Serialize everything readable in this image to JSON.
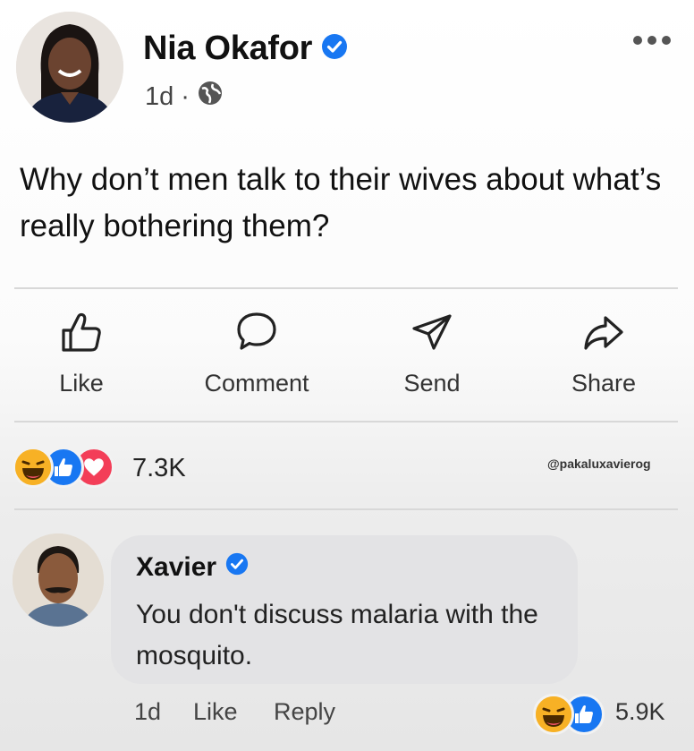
{
  "post": {
    "author": "Nia Okafor",
    "time": "1d",
    "separator": "·",
    "text": "Why don’t men talk to their wives about what’s really bothering them?"
  },
  "actions": {
    "like": "Like",
    "comment": "Comment",
    "send": "Send",
    "share": "Share"
  },
  "reactions": {
    "icons": [
      "haha-icon",
      "like-icon",
      "love-icon"
    ],
    "count": "7.3K",
    "watermark": "@pakaluxavierog"
  },
  "comment": {
    "author": "Xavier",
    "text": "You don't discuss malaria with the mosquito.",
    "time": "1d",
    "like": "Like",
    "reply": "Reply",
    "reaction_icons": [
      "haha-icon",
      "like-icon"
    ],
    "reaction_count": "5.9K"
  },
  "colors": {
    "verified": "#1877f2",
    "like_blue": "#1877f2",
    "love_red": "#f33e58",
    "haha_yellow": "#f7b125"
  }
}
